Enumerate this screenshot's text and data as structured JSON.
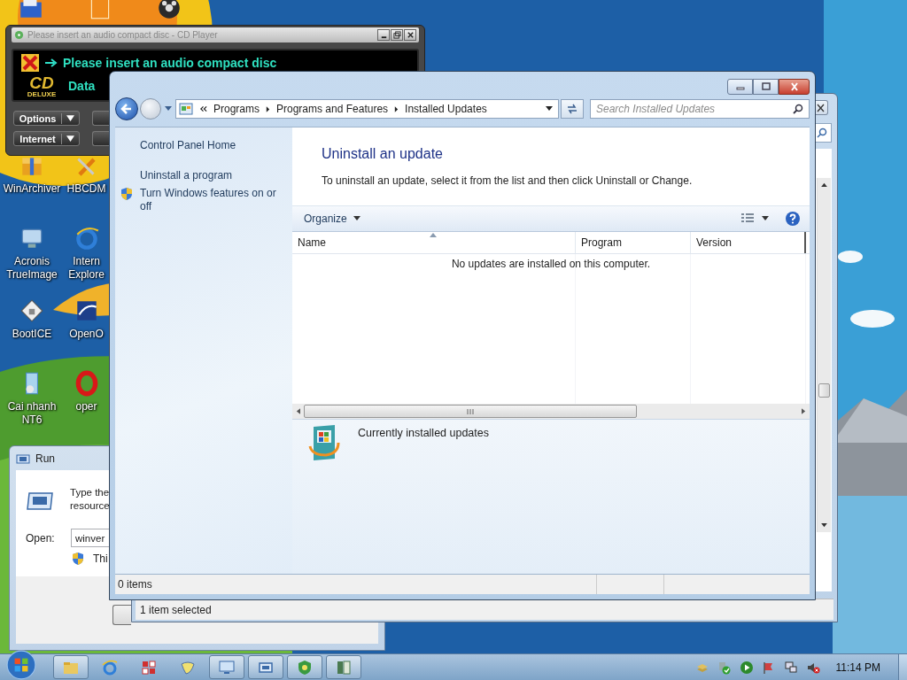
{
  "desktop_icons": [
    {
      "lines": [
        "WinArchiver"
      ]
    },
    {
      "lines": [
        "HBCDM"
      ]
    },
    {
      "lines": [
        "Acronis",
        "TrueImage"
      ]
    },
    {
      "lines": [
        "Intern",
        "Explore"
      ]
    },
    {
      "lines": [
        "BootICE"
      ]
    },
    {
      "lines": [
        "OpenO"
      ]
    },
    {
      "lines": [
        "Cai nhanh",
        "NT6"
      ]
    },
    {
      "lines": [
        "oper"
      ]
    }
  ],
  "cd_player": {
    "title": "Please insert an audio compact disc - CD Player",
    "message": "Please insert an audio compact disc",
    "status": "Data",
    "logo": "CD",
    "logo_sub": "DELUXE",
    "buttons": [
      "Options",
      "Internet"
    ]
  },
  "run_dialog": {
    "title": "Run",
    "prompt_lines": [
      "Type the",
      "resource"
    ],
    "open_label": "Open:",
    "value": "winver",
    "note": "Thi"
  },
  "back_window": {
    "status_bar": {
      "text": "1 item selected"
    }
  },
  "window": {
    "breadcrumb": [
      "Programs",
      "Programs and Features",
      "Installed Updates"
    ],
    "search": {
      "placeholder": "Search Installed Updates"
    },
    "sidebar": {
      "items": [
        {
          "label": "Control Panel Home",
          "kind": "link"
        },
        {
          "label": "Uninstall a program",
          "kind": "link"
        },
        {
          "label": "Turn Windows features on or off",
          "kind": "shield"
        }
      ]
    },
    "heading": "Uninstall an update",
    "description": "To uninstall an update, select it from the list and then click Uninstall or Change.",
    "toolbar": {
      "organize": "Organize"
    },
    "table": {
      "columns": [
        {
          "label": "Name",
          "sorted": true
        },
        {
          "label": "Program",
          "sorted": false
        },
        {
          "label": "Version",
          "sorted": false
        }
      ],
      "empty_message": "No updates are installed on this computer."
    },
    "details": {
      "label": "Currently installed updates"
    },
    "status_bar": {
      "text": "0 items"
    }
  },
  "taskbar": {
    "items": [
      {
        "open": true
      },
      {
        "open": false
      },
      {
        "open": false
      },
      {
        "open": false
      },
      {
        "open": true
      },
      {
        "open": true
      },
      {
        "open": true
      },
      {
        "open": true
      }
    ],
    "clock": "11:14 PM"
  }
}
